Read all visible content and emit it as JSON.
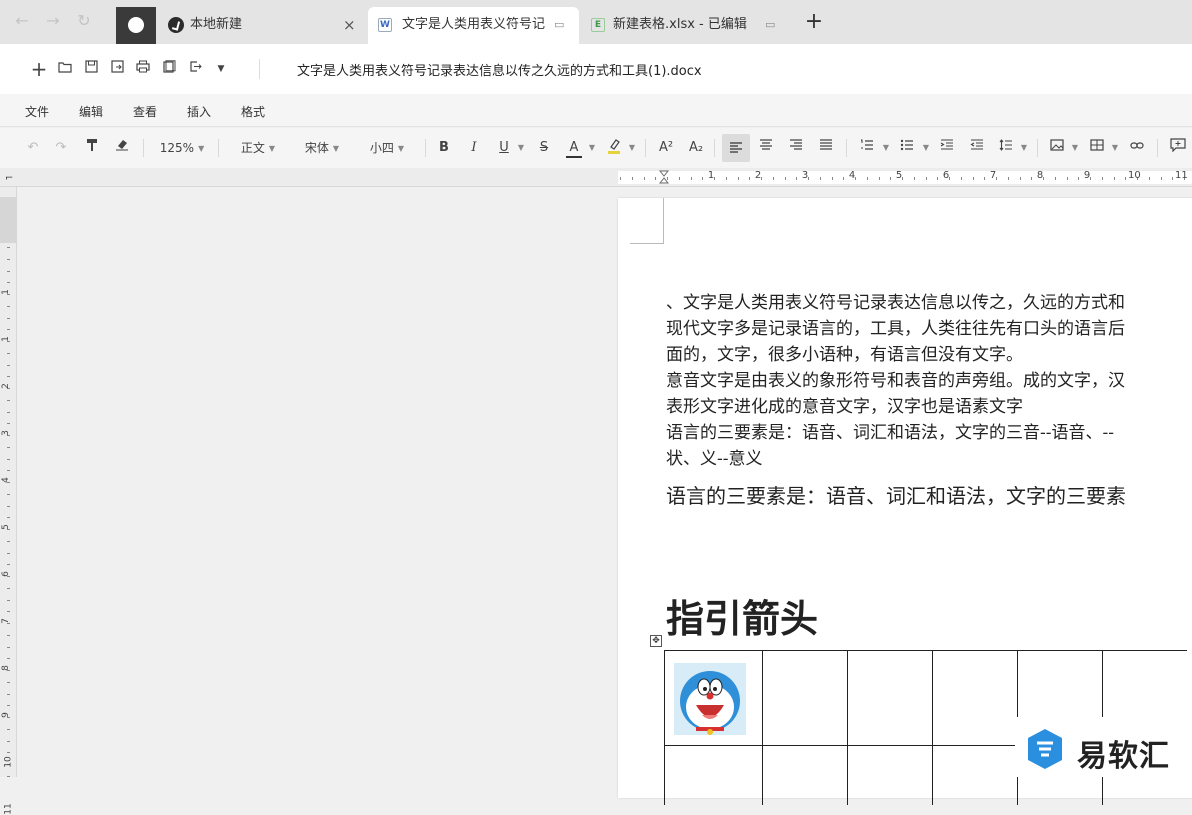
{
  "tabs": [
    {
      "label": "本地新建"
    },
    {
      "label": "文字是人类用表义符号记",
      "icon_letter": "W"
    },
    {
      "label": "新建表格.xlsx - 已编辑",
      "icon_letter": "E"
    }
  ],
  "nav": {
    "back": "←",
    "forward": "→",
    "reload": "↻",
    "new_tab": "+",
    "close": "×"
  },
  "document": {
    "title": "文字是人类用表义符号记录表达信息以传之久远的方式和工具(1).docx"
  },
  "menu": [
    "文件",
    "编辑",
    "查看",
    "插入",
    "格式"
  ],
  "format_toolbar": {
    "zoom": "125%",
    "style": "正文",
    "font": "宋体",
    "size": "小四",
    "bold": "B",
    "italic": "I",
    "underline": "U",
    "strike": "S",
    "font_color": "A",
    "superscript": "A²",
    "subscript": "A₂"
  },
  "ruler": {
    "numbers": [
      "1",
      "1",
      "2",
      "3",
      "4",
      "5",
      "6",
      "7",
      "8",
      "9",
      "10",
      "11"
    ],
    "vnumbers": [
      "1",
      "1",
      "2",
      "3",
      "4",
      "5",
      "6",
      "7",
      "8",
      "9",
      "10",
      "11"
    ]
  },
  "body": {
    "lines": [
      "、文字是人类用表义符号记录表达信息以传之，久远的方式和",
      "现代文字多是记录语言的，工具，人类往往先有口头的语言后",
      "面的，文字，很多小语种，有语言但没有文字。",
      "意音文字是由表义的象形符号和表音的声旁组。成的文字，汉",
      "表形文字进化成的意音文字，汉字也是语素文字",
      "语言的三要素是：语音、词汇和语法，文字的三音--语音、--",
      "状、义--意义"
    ],
    "large_line": "语言的三要素是：语音、词汇和语法，文字的三要素",
    "heading": "指引箭头"
  },
  "watermark": {
    "text": "易软汇"
  }
}
